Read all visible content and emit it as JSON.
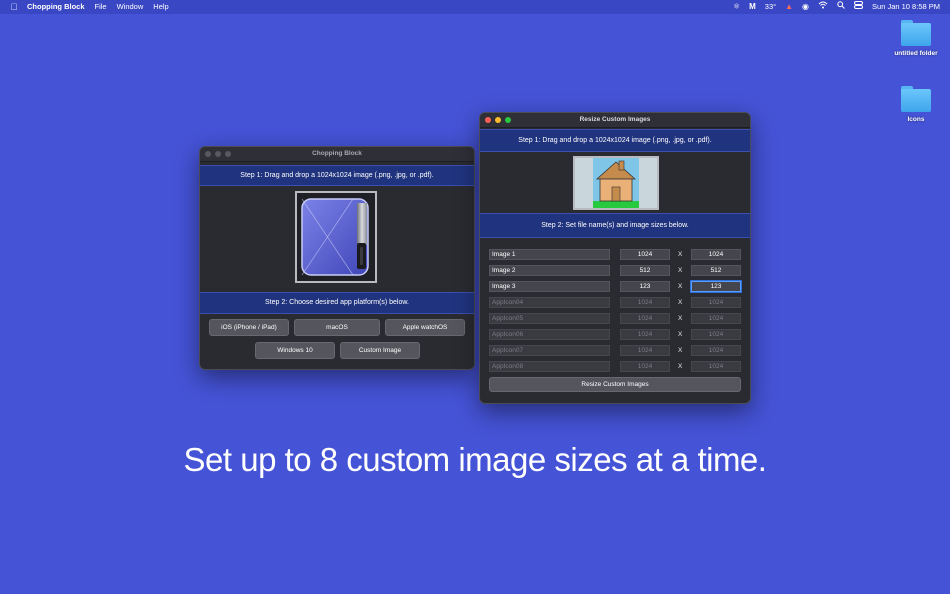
{
  "menubar": {
    "app_name": "Chopping Block",
    "items": [
      "File",
      "Window",
      "Help"
    ],
    "temperature": "33°",
    "datetime": "Sun Jan 10  8:58 PM"
  },
  "desktop": {
    "icons": [
      {
        "label": "untitled folder"
      },
      {
        "label": "Icons"
      }
    ]
  },
  "chopping_block": {
    "title": "Chopping Block",
    "step1": "Step 1: Drag and drop a 1024x1024 image (.png, .jpg, or .pdf).",
    "step2": "Step 2: Choose desired app platform(s) below.",
    "buttons": {
      "ios": "iOS (iPhone / iPad)",
      "macos": "macOS",
      "watchos": "Apple watchOS",
      "windows": "Windows 10",
      "custom": "Custom Image"
    }
  },
  "resize": {
    "title": "Resize Custom Images",
    "step1": "Step 1: Drag and drop a 1024x1024 image (.png, .jpg, or .pdf).",
    "step2": "Step 2: Set file name(s) and image sizes below.",
    "x_label": "X",
    "rows": [
      {
        "name": "Image 1",
        "w": "1024",
        "h": "1024"
      },
      {
        "name": "Image 2",
        "w": "512",
        "h": "512"
      },
      {
        "name": "Image 3",
        "w": "123",
        "h": "123"
      },
      {
        "name": "AppIcon04",
        "w": "1024",
        "h": "1024"
      },
      {
        "name": "AppIcon05",
        "w": "1024",
        "h": "1024"
      },
      {
        "name": "AppIcon06",
        "w": "1024",
        "h": "1024"
      },
      {
        "name": "AppIcon07",
        "w": "1024",
        "h": "1024"
      },
      {
        "name": "AppIcon08",
        "w": "1024",
        "h": "1024"
      }
    ],
    "resize_button": "Resize Custom Images"
  },
  "tagline": "Set up to 8 custom image sizes at a time."
}
